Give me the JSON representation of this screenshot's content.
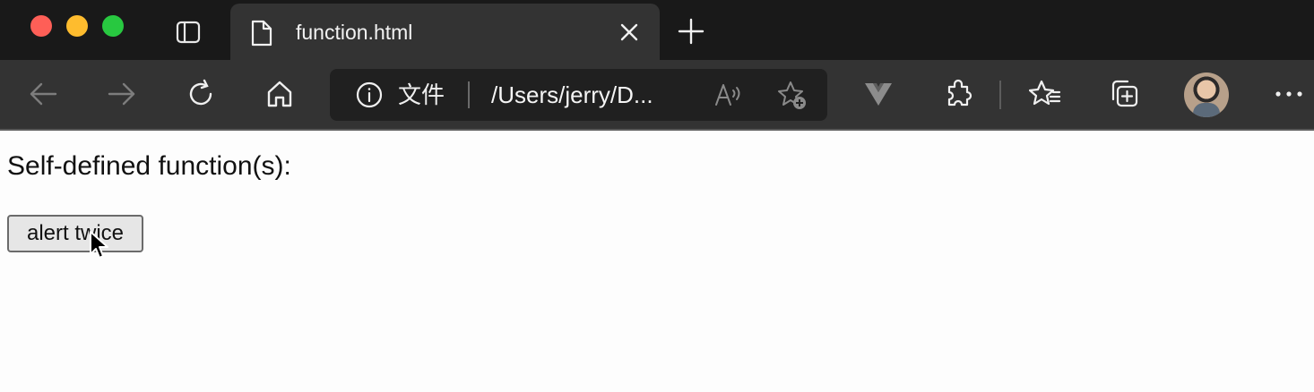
{
  "tab": {
    "title": "function.html"
  },
  "toolbar": {
    "site_label": "文件",
    "url": "/Users/jerry/D..."
  },
  "page": {
    "heading": "Self-defined function(s):",
    "button_label": "alert twice"
  },
  "colors": {
    "tabbar_bg": "#191919",
    "toolbar_bg": "#333333",
    "address_bg": "#202020",
    "page_bg": "#fdfdfd"
  },
  "icons": [
    "close-window-icon",
    "minimize-window-icon",
    "maximize-window-icon",
    "tab-actions-icon",
    "file-icon",
    "close-icon",
    "plus-icon",
    "back-arrow-icon",
    "forward-arrow-icon",
    "refresh-icon",
    "home-icon",
    "info-icon",
    "read-aloud-icon",
    "add-favorite-icon",
    "vue-devtools-icon",
    "extensions-icon",
    "favorites-icon",
    "collections-icon",
    "more-icon",
    "mouse-cursor-icon"
  ]
}
